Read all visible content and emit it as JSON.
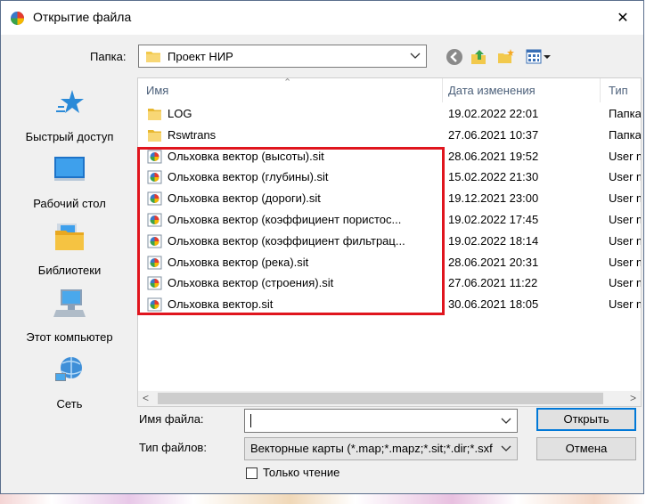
{
  "window": {
    "title": "Открытие файла",
    "close_label": "✕"
  },
  "toolbar": {
    "folder_label": "Папка:",
    "folder_value": "Проект НИР"
  },
  "places": [
    {
      "label": "Быстрый доступ",
      "icon": "star-icon"
    },
    {
      "label": "Рабочий стол",
      "icon": "desktop-icon"
    },
    {
      "label": "Библиотеки",
      "icon": "library-icon"
    },
    {
      "label": "Этот компьютер",
      "icon": "computer-icon"
    },
    {
      "label": "Сеть",
      "icon": "network-icon"
    }
  ],
  "columns": {
    "name": "Имя",
    "date": "Дата изменения",
    "type": "Тип"
  },
  "files": [
    {
      "name": "LOG",
      "date": "19.02.2022 22:01",
      "type": "Папка",
      "icon": "folder"
    },
    {
      "name": "Rswtrans",
      "date": "27.06.2021 10:37",
      "type": "Папка",
      "icon": "folder"
    },
    {
      "name": "Ольховка вектор (высоты).sit",
      "date": "28.06.2021 19:52",
      "type": "User map",
      "icon": "sit"
    },
    {
      "name": "Ольховка вектор (глубины).sit",
      "date": "15.02.2022 21:30",
      "type": "User map",
      "icon": "sit"
    },
    {
      "name": "Ольховка вектор (дороги).sit",
      "date": "19.12.2021 23:00",
      "type": "User map",
      "icon": "sit"
    },
    {
      "name": "Ольховка вектор (коэффициент пористос...",
      "date": "19.02.2022 17:45",
      "type": "User map",
      "icon": "sit"
    },
    {
      "name": "Ольховка вектор (коэффициент фильтрац...",
      "date": "19.02.2022 18:14",
      "type": "User map",
      "icon": "sit"
    },
    {
      "name": "Ольховка вектор (река).sit",
      "date": "28.06.2021 20:31",
      "type": "User map",
      "icon": "sit"
    },
    {
      "name": "Ольховка вектор (строения).sit",
      "date": "27.06.2021 11:22",
      "type": "User map",
      "icon": "sit"
    },
    {
      "name": "Ольховка вектор.sit",
      "date": "30.06.2021 18:05",
      "type": "User map",
      "icon": "sit"
    }
  ],
  "form": {
    "filename_label": "Имя файла:",
    "filename_value": "",
    "filetype_label": "Тип файлов:",
    "filetype_value": "Векторные карты (*.map;*.mapz;*.sit;*.dir;*.sxf",
    "readonly_label": "Только чтение",
    "readonly_checked": false,
    "open_button": "Открыть",
    "cancel_button": "Отмена"
  },
  "colors": {
    "accent": "#0078d7",
    "highlight_border": "#e0151e",
    "folder": "#f2c94c",
    "header_text": "#4c607a"
  }
}
